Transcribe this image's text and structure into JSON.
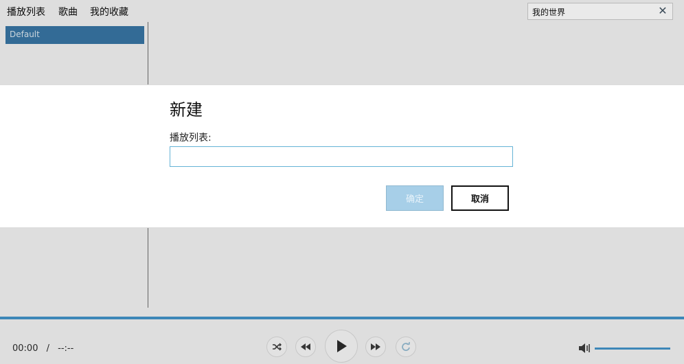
{
  "menu": {
    "playlists": "播放列表",
    "songs": "歌曲",
    "favorites": "我的收藏"
  },
  "search": {
    "value": "我的世界",
    "clear_icon": "close-icon"
  },
  "sidebar": {
    "items": [
      {
        "label": "Default",
        "selected": true
      }
    ]
  },
  "player": {
    "current_time": "00:00",
    "separator": "/",
    "total_time": "--:--",
    "controls": [
      "shuffle-icon",
      "previous-icon",
      "play-icon",
      "next-icon",
      "repeat-icon"
    ],
    "volume": 1.0,
    "accent_color": "#3b8fc7"
  },
  "dialog": {
    "title": "新建",
    "field_label": "播放列表:",
    "input_value": "",
    "ok_label": "确定",
    "cancel_label": "取消"
  }
}
